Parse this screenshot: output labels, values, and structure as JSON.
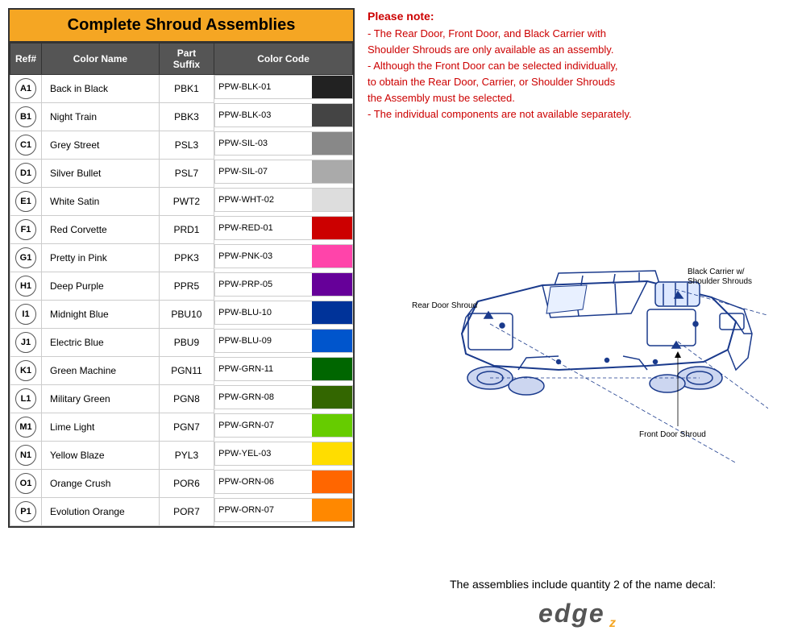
{
  "table": {
    "title": "Complete Shroud Assemblies",
    "headers": [
      "Ref#",
      "Color Name",
      "Part\nSuffix",
      "Color Code"
    ],
    "rows": [
      {
        "ref": "A1",
        "color_name": "Back in Black",
        "part_suffix": "PBK1",
        "color_code": "PPW-BLK-01",
        "swatch": "#222222"
      },
      {
        "ref": "B1",
        "color_name": "Night Train",
        "part_suffix": "PBK3",
        "color_code": "PPW-BLK-03",
        "swatch": "#444444"
      },
      {
        "ref": "C1",
        "color_name": "Grey Street",
        "part_suffix": "PSL3",
        "color_code": "PPW-SIL-03",
        "swatch": "#888888"
      },
      {
        "ref": "D1",
        "color_name": "Silver Bullet",
        "part_suffix": "PSL7",
        "color_code": "PPW-SIL-07",
        "swatch": "#aaaaaa"
      },
      {
        "ref": "E1",
        "color_name": "White Satin",
        "part_suffix": "PWT2",
        "color_code": "PPW-WHT-02",
        "swatch": "#dddddd"
      },
      {
        "ref": "F1",
        "color_name": "Red Corvette",
        "part_suffix": "PRD1",
        "color_code": "PPW-RED-01",
        "swatch": "#cc0000"
      },
      {
        "ref": "G1",
        "color_name": "Pretty in Pink",
        "part_suffix": "PPK3",
        "color_code": "PPW-PNK-03",
        "swatch": "#ff44aa"
      },
      {
        "ref": "H1",
        "color_name": "Deep Purple",
        "part_suffix": "PPR5",
        "color_code": "PPW-PRP-05",
        "swatch": "#660099"
      },
      {
        "ref": "I1",
        "color_name": "Midnight Blue",
        "part_suffix": "PBU10",
        "color_code": "PPW-BLU-10",
        "swatch": "#003399"
      },
      {
        "ref": "J1",
        "color_name": "Electric Blue",
        "part_suffix": "PBU9",
        "color_code": "PPW-BLU-09",
        "swatch": "#0055cc"
      },
      {
        "ref": "K1",
        "color_name": "Green Machine",
        "part_suffix": "PGN11",
        "color_code": "PPW-GRN-11",
        "swatch": "#006600"
      },
      {
        "ref": "L1",
        "color_name": "Military Green",
        "part_suffix": "PGN8",
        "color_code": "PPW-GRN-08",
        "swatch": "#336600"
      },
      {
        "ref": "M1",
        "color_name": "Lime Light",
        "part_suffix": "PGN7",
        "color_code": "PPW-GRN-07",
        "swatch": "#66cc00"
      },
      {
        "ref": "N1",
        "color_name": "Yellow Blaze",
        "part_suffix": "PYL3",
        "color_code": "PPW-YEL-03",
        "swatch": "#ffdd00"
      },
      {
        "ref": "O1",
        "color_name": "Orange Crush",
        "part_suffix": "POR6",
        "color_code": "PPW-ORN-06",
        "swatch": "#ff6600"
      },
      {
        "ref": "P1",
        "color_name": "Evolution Orange",
        "part_suffix": "POR7",
        "color_code": "PPW-ORN-07",
        "swatch": "#ff8800"
      }
    ]
  },
  "notes": {
    "title": "Please note:",
    "lines": [
      "- The Rear Door, Front Door, and Black Carrier with",
      "  Shoulder Shrouds are only available as an assembly.",
      "- Although the Front Door can be selected individually,",
      "  to obtain the Rear Door, Carrier, or Shoulder Shrouds",
      "  the Assembly must be selected.",
      "- The individual components are not available separately."
    ]
  },
  "diagram": {
    "labels": {
      "rear_door": "Rear Door Shroud",
      "black_carrier": "Black Carrier w/\nShoulder Shrouds",
      "front_door": "Front Door Shroud"
    }
  },
  "bottom": {
    "text": "The assemblies include quantity 2 of the name decal:",
    "logo": "edge"
  }
}
